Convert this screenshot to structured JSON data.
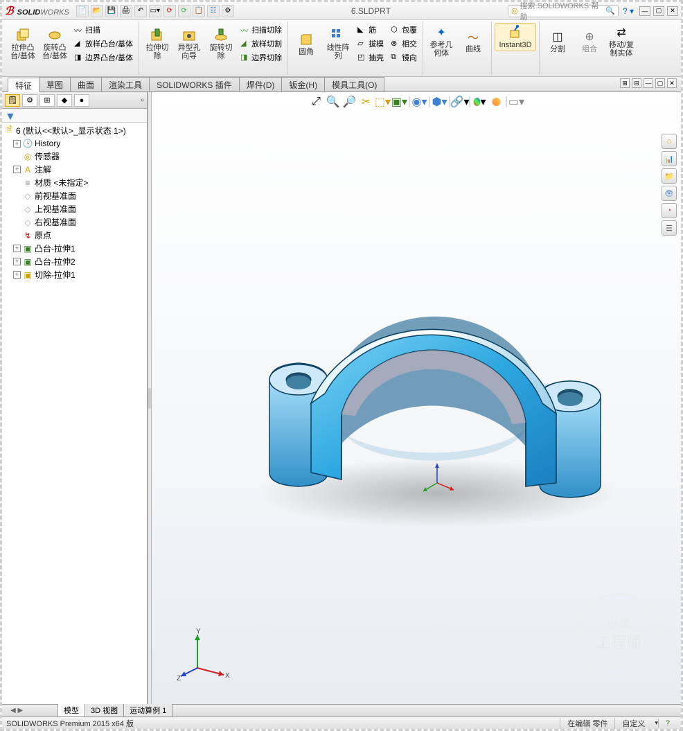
{
  "app": {
    "name_bold": "SOLID",
    "name_light": "WORKS"
  },
  "qat": [
    "new",
    "open",
    "save",
    "print",
    "undo",
    "redo",
    "select",
    "rebuild",
    "options",
    "settings",
    "screen"
  ],
  "filename": "6.SLDPRT",
  "search": {
    "placeholder": "搜索 SOLIDWORKS 帮助"
  },
  "help_icon": "?",
  "ribbon": {
    "extrude": "拉伸凸台/基体",
    "revolve": "旋转凸台/基体",
    "sweep": "扫描",
    "loft": "放样凸台/基体",
    "boundary": "边界凸台/基体",
    "cut_extrude": "拉伸切除",
    "hole_wizard": "异型孔向导",
    "cut_revolve": "旋转切除",
    "sweep_cut": "扫描切除",
    "loft_cut": "放样切割",
    "boundary_cut": "边界切除",
    "fillet": "圆角",
    "pattern": "线性阵列",
    "rib": "筋",
    "draft": "拔模",
    "shell": "抽壳",
    "wrap": "包覆",
    "intersect": "相交",
    "mirror": "镜向",
    "refgeom": "参考几何体",
    "curves": "曲线",
    "instant3d": "Instant3D",
    "split": "分割",
    "combine": "组合",
    "move_copy": "移动/复制实体"
  },
  "tabs": [
    "特征",
    "草图",
    "曲面",
    "渲染工具",
    "SOLIDWORKS 插件",
    "焊件(D)",
    "钣金(H)",
    "模具工具(O)"
  ],
  "tree": {
    "root": "6  (默认<<默认>_显示状态 1>)",
    "items": [
      {
        "icon": "history",
        "label": "History",
        "exp": "+"
      },
      {
        "icon": "sensor",
        "label": "传感器",
        "exp": ""
      },
      {
        "icon": "annot",
        "label": "注解",
        "exp": "+"
      },
      {
        "icon": "material",
        "label": "材质 <未指定>",
        "exp": ""
      },
      {
        "icon": "plane",
        "label": "前视基准面",
        "exp": ""
      },
      {
        "icon": "plane",
        "label": "上视基准面",
        "exp": ""
      },
      {
        "icon": "plane",
        "label": "右视基准面",
        "exp": ""
      },
      {
        "icon": "origin",
        "label": "原点",
        "exp": ""
      },
      {
        "icon": "extrude",
        "label": "凸台-拉伸1",
        "exp": "+"
      },
      {
        "icon": "extrude",
        "label": "凸台-拉伸2",
        "exp": "+"
      },
      {
        "icon": "cut",
        "label": "切除-拉伸1",
        "exp": "+"
      }
    ]
  },
  "bottom_tabs": [
    "模型",
    "3D 视图",
    "运动算例 1"
  ],
  "status": {
    "left": "SOLIDWORKS Premium 2015 x64 版",
    "mode": "在编辑 零件",
    "custom": "自定义"
  },
  "watermark_top": "小 國",
  "watermark_bottom": "工程师",
  "triad": {
    "x": "X",
    "y": "Y",
    "z": "Z"
  }
}
